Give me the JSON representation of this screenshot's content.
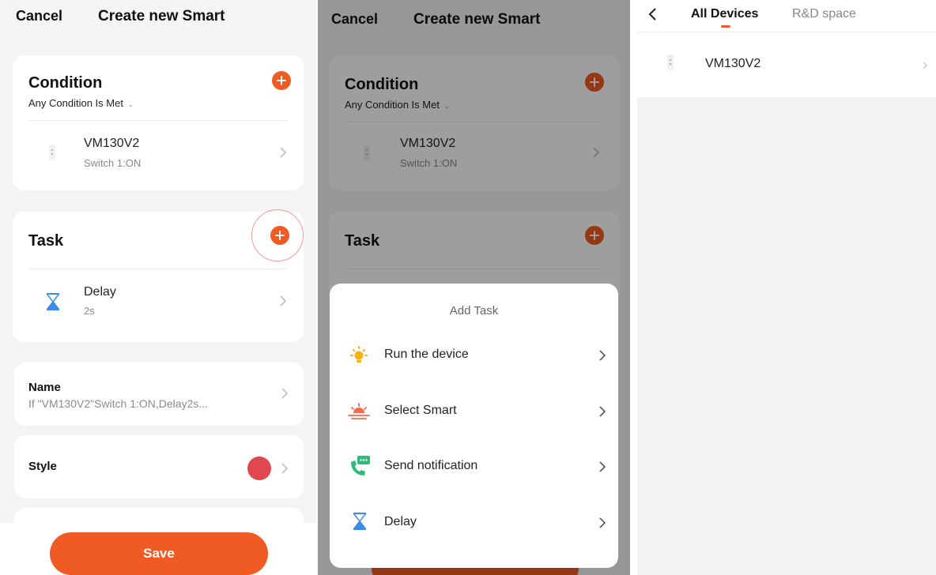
{
  "screen1": {
    "header": {
      "cancel": "Cancel",
      "title": "Create new Smart"
    },
    "condition": {
      "title": "Condition",
      "mode": "Any Condition Is Met",
      "item": {
        "name": "VM130V2",
        "detail": "Switch 1:ON"
      }
    },
    "task": {
      "title": "Task",
      "item": {
        "name": "Delay",
        "detail": "2s"
      }
    },
    "name_field": {
      "label": "Name",
      "value": "If \"VM130V2\"Switch 1:ON,Delay2s..."
    },
    "style_field": {
      "label": "Style",
      "color": "#e0484f"
    },
    "save_label": "Save"
  },
  "screen2": {
    "header": {
      "cancel": "Cancel",
      "title": "Create new Smart"
    },
    "condition": {
      "title": "Condition",
      "mode": "Any Condition Is Met",
      "item": {
        "name": "VM130V2",
        "detail": "Switch 1:ON"
      }
    },
    "task": {
      "title": "Task"
    },
    "add_task_sheet": {
      "title": "Add Task",
      "options": [
        {
          "label": "Run the device",
          "icon": "bulb-icon"
        },
        {
          "label": "Select Smart",
          "icon": "sunrise-icon"
        },
        {
          "label": "Send notification",
          "icon": "phone-message-icon"
        },
        {
          "label": "Delay",
          "icon": "hourglass-icon"
        }
      ]
    }
  },
  "screen3": {
    "tabs": [
      {
        "label": "All Devices",
        "active": true
      },
      {
        "label": "R&D space",
        "active": false
      }
    ],
    "devices": [
      {
        "name": "VM130V2"
      }
    ]
  },
  "colors": {
    "accent": "#f05a23",
    "delay_icon": "#3c8be8",
    "background": "#f4f4f4"
  }
}
